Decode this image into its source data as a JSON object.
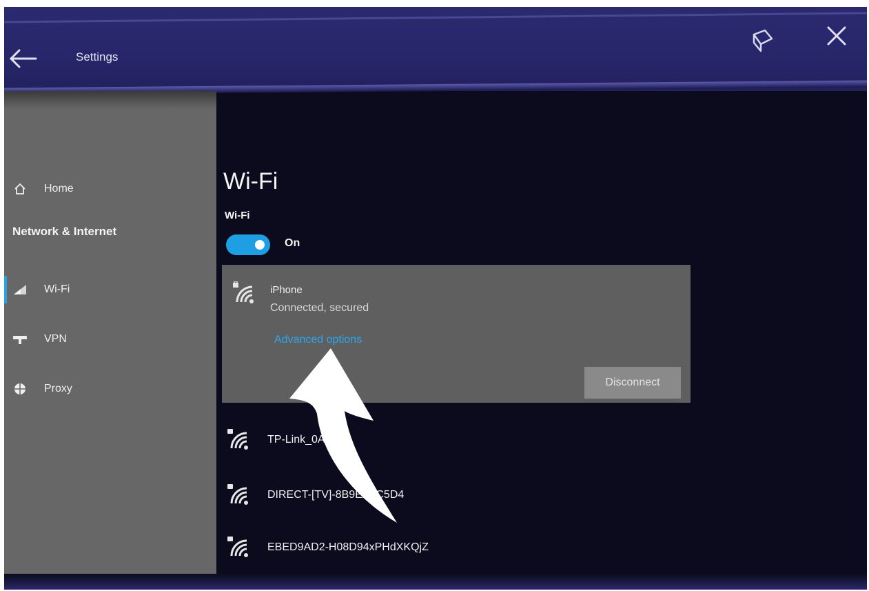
{
  "window": {
    "title": "Settings"
  },
  "sidebar": {
    "home_label": "Home",
    "section_label": "Network & Internet",
    "items": [
      {
        "label": "Wi-Fi",
        "icon": "wifi-signal-icon",
        "active": true
      },
      {
        "label": "VPN",
        "icon": "vpn-icon",
        "active": false
      },
      {
        "label": "Proxy",
        "icon": "globe-icon",
        "active": false
      }
    ]
  },
  "main": {
    "page_title": "Wi-Fi",
    "wifi_label": "Wi-Fi",
    "toggle_state": "On",
    "connected_network": {
      "name": "iPhone",
      "status": "Connected, secured",
      "advanced_link": "Advanced options",
      "disconnect_label": "Disconnect"
    },
    "networks": [
      {
        "name": "TP-Link_0AF4"
      },
      {
        "name": "DIRECT-[TV]-8B9EA0C5D4"
      },
      {
        "name": "EBED9AD2-H08D94xPHdXKQjZ"
      }
    ]
  },
  "colors": {
    "accent": "#1f9fe3",
    "link": "#2fa5ea",
    "titlebar": "#27266a",
    "sidebar": "#676767",
    "content_bg": "#0c0b1e"
  }
}
